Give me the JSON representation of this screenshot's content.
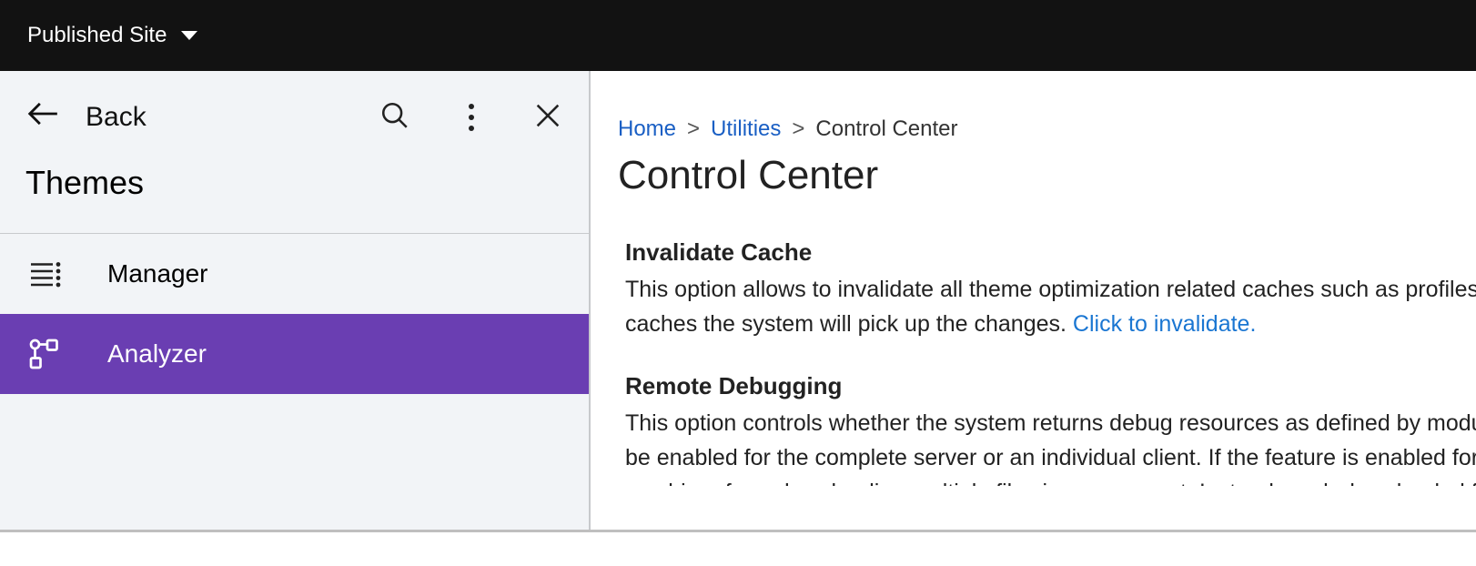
{
  "topbar": {
    "site_selector": "Published Site"
  },
  "sidebar": {
    "back_label": "Back",
    "title": "Themes",
    "items": [
      {
        "label": "Manager",
        "active": false
      },
      {
        "label": "Analyzer",
        "active": true
      }
    ]
  },
  "breadcrumb": {
    "home": "Home",
    "utilities": "Utilities",
    "current": "Control Center",
    "separator": ">"
  },
  "page": {
    "title": "Control Center"
  },
  "sections": {
    "invalidate": {
      "heading": "Invalidate Cache",
      "line1_prefix": "This option allows to invalidate all theme optimization related caches such as profiles a",
      "line2_prefix": "caches the system will pick up the changes. ",
      "link": "Click to invalidate."
    },
    "remote": {
      "heading": "Remote Debugging",
      "line1": "This option controls whether the system returns debug resources as defined by modul",
      "line2": "be enabled for the complete server or an individual client. If the feature is enabled for t",
      "line3": "combiner from downloading multiple files in one request. Instead, each downloaded fil"
    }
  }
}
